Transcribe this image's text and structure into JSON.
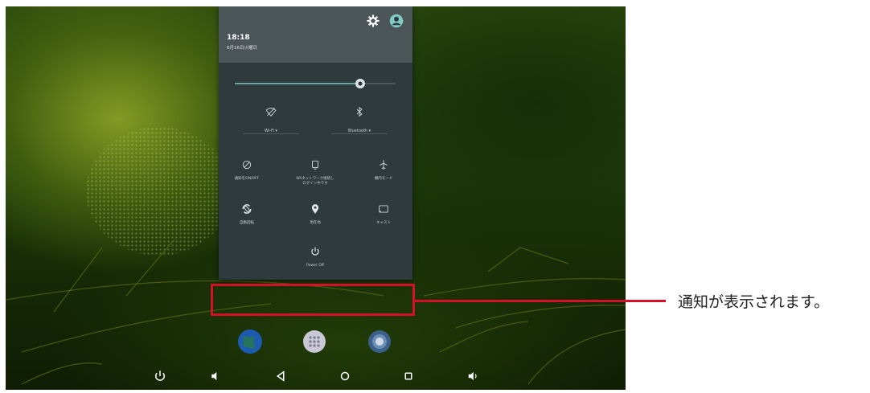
{
  "status": {
    "time": "18:18",
    "date": "6月16日火曜日"
  },
  "brightness": {
    "level": 0.78
  },
  "quick_settings": {
    "wifi_label": "Wi-Fi ▾",
    "bluetooth_label": "Bluetooth ▾",
    "tiles": [
      {
        "label": "通知をON/OFF",
        "icon": "notification-toggle-icon"
      },
      {
        "label": "Wiiネットワーク接続し\nログイン中です",
        "icon": "network-icon"
      },
      {
        "label": "機内モード",
        "icon": "airplane-icon"
      },
      {
        "label": "自動回転",
        "icon": "rotation-icon"
      },
      {
        "label": "現在地",
        "icon": "location-icon"
      },
      {
        "label": "キャスト",
        "icon": "cast-icon"
      }
    ],
    "power_label": "Power Off"
  },
  "dock": {
    "apps": [
      "browser-icon",
      "app-drawer-icon",
      "camera-icon"
    ]
  },
  "navbar": {
    "buttons": [
      "power-icon",
      "volume-down-icon",
      "back-icon",
      "home-icon",
      "recents-icon",
      "volume-up-icon"
    ]
  },
  "annotation": {
    "text": "通知が表示されます。",
    "color": "#d7102a"
  },
  "colors": {
    "accent": "#80cbc4",
    "panel": "#2f3a3f",
    "panel_header": "#4c5659"
  }
}
